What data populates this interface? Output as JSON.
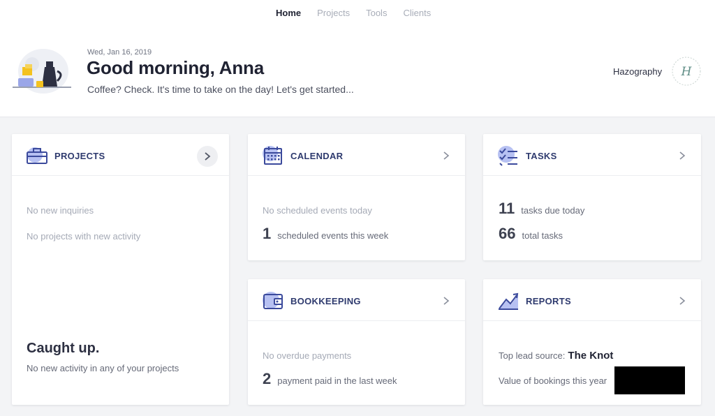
{
  "nav": {
    "items": [
      {
        "label": "Home",
        "active": true
      },
      {
        "label": "Projects",
        "active": false
      },
      {
        "label": "Tools",
        "active": false
      },
      {
        "label": "Clients",
        "active": false
      }
    ]
  },
  "header": {
    "date": "Wed, Jan 16, 2019",
    "greeting": "Good morning, Anna",
    "subline": "Coffee? Check. It's time to take on the day! Let's get started...",
    "brand_name": "Hazography",
    "brand_logo_letter": "H",
    "illustration": "coffee-morning-illustration"
  },
  "colors": {
    "accent": "#3b4a9c",
    "icon_blob": "#b7c1f2",
    "title": "#2e3a6e"
  },
  "cards": {
    "projects": {
      "icon": "briefcase-icon",
      "title": "PROJECTS",
      "line1": "No new inquiries",
      "line2": "No projects with new activity",
      "caught_title": "Caught up.",
      "caught_sub": "No new activity in any of your projects"
    },
    "calendar": {
      "icon": "calendar-icon",
      "title": "CALENDAR",
      "line1": "No scheduled events today",
      "stat_num": "1",
      "stat_label": "scheduled events this week"
    },
    "tasks": {
      "icon": "checklist-icon",
      "title": "TASKS",
      "stat1_num": "11",
      "stat1_label": "tasks due today",
      "stat2_num": "66",
      "stat2_label": "total tasks"
    },
    "bookkeeping": {
      "icon": "wallet-icon",
      "title": "BOOKKEEPING",
      "line1": "No overdue payments",
      "stat_num": "2",
      "stat_label": "payment paid in the last week"
    },
    "reports": {
      "icon": "trend-chart-icon",
      "title": "REPORTS",
      "lead_label": "Top lead source:",
      "lead_value": "The Knot",
      "bookings_label": "Value of bookings this year"
    }
  }
}
